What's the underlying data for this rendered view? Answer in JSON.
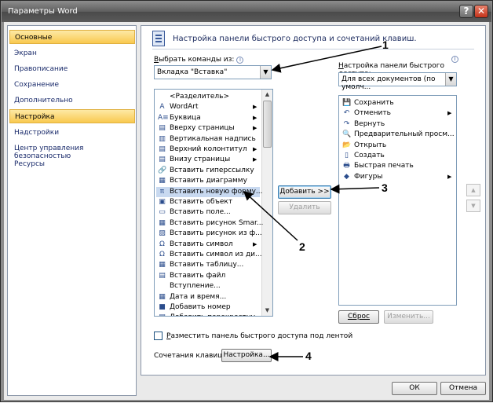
{
  "window": {
    "title": "Параметры Word"
  },
  "nav": {
    "items": [
      {
        "label": "Основные",
        "selected": true
      },
      {
        "label": "Экран",
        "selected": false
      },
      {
        "label": "Правописание",
        "selected": false
      },
      {
        "label": "Сохранение",
        "selected": false
      },
      {
        "label": "Дополнительно",
        "selected": false
      },
      {
        "label": "Настройка",
        "selected": true
      },
      {
        "label": "Надстройки",
        "selected": false
      },
      {
        "label": "Центр управления безопасностью",
        "selected": false
      },
      {
        "label": "Ресурсы",
        "selected": false
      }
    ]
  },
  "header": {
    "text": "Настройка панели быстрого доступа и сочетаний клавиш."
  },
  "commands": {
    "label_pre": "В",
    "label_rest": "ыбрать команды из:",
    "combo_value": "Вкладка \"Вставка\"",
    "items": [
      {
        "label": "<Разделитель>",
        "icon": "",
        "submenu": false
      },
      {
        "label": "WordArt",
        "icon": "A",
        "submenu": true
      },
      {
        "label": "Буквица",
        "icon": "A≡",
        "submenu": true
      },
      {
        "label": "Вверху страницы",
        "icon": "▤",
        "submenu": true
      },
      {
        "label": "Вертикальная надпись",
        "icon": "▥",
        "submenu": false
      },
      {
        "label": "Верхний колонтитул",
        "icon": "▤",
        "submenu": true
      },
      {
        "label": "Внизу страницы",
        "icon": "▤",
        "submenu": true
      },
      {
        "label": "Вставить гиперссылку",
        "icon": "🔗",
        "submenu": false
      },
      {
        "label": "Вставить диаграмму",
        "icon": "▦",
        "submenu": false
      },
      {
        "label": "Вставить новую форму...",
        "icon": "π",
        "submenu": false
      },
      {
        "label": "Вставить объект",
        "icon": "▣",
        "submenu": false
      },
      {
        "label": "Вставить поле...",
        "icon": "▭",
        "submenu": false
      },
      {
        "label": "Вставить рисунок Smar...",
        "icon": "▦",
        "submenu": false
      },
      {
        "label": "Вставить рисунок из ф...",
        "icon": "▨",
        "submenu": false
      },
      {
        "label": "Вставить символ",
        "icon": "Ω",
        "submenu": true
      },
      {
        "label": "Вставить символ из ди...",
        "icon": "Ω",
        "submenu": false
      },
      {
        "label": "Вставить таблицу...",
        "icon": "▦",
        "submenu": false
      },
      {
        "label": "Вставить файл",
        "icon": "▤",
        "submenu": false
      },
      {
        "label": "Вступление...",
        "icon": "",
        "submenu": false
      },
      {
        "label": "Дата и время...",
        "icon": "▦",
        "submenu": false
      },
      {
        "label": "Добавить номер",
        "icon": "■",
        "submenu": false
      },
      {
        "label": "Добавить перекрестну...",
        "icon": "▤",
        "submenu": false
      }
    ],
    "selected_index": 9
  },
  "qat": {
    "label_pre": "Н",
    "label_rest": "астройка панели быстрого\nдоступа:",
    "combo_value": "Для всех документов (по умолч...",
    "items": [
      {
        "label": "Сохранить",
        "icon": "💾",
        "submenu": false
      },
      {
        "label": "Отменить",
        "icon": "↶",
        "submenu": true
      },
      {
        "label": "Вернуть",
        "icon": "↷",
        "submenu": false
      },
      {
        "label": "Предварительный просм...",
        "icon": "🔍",
        "submenu": false
      },
      {
        "label": "Открыть",
        "icon": "📂",
        "submenu": false
      },
      {
        "label": "Создать",
        "icon": "▯",
        "submenu": false
      },
      {
        "label": "Быстрая печать",
        "icon": "🖶",
        "submenu": false
      },
      {
        "label": "Фигуры",
        "icon": "◆",
        "submenu": true
      }
    ]
  },
  "buttons": {
    "add": "Добавить >>",
    "remove": "Удалить",
    "reset": "Сброс",
    "modify": "Изменить...",
    "customize": "Настройка...",
    "ok": "ОК",
    "cancel": "Отмена"
  },
  "options": {
    "below_ribbon_pre": "Р",
    "below_ribbon_rest": "азместить панель быстрого доступа под лентой",
    "shortcuts_label": "Сочетания клавиш:"
  },
  "callouts": [
    "1",
    "2",
    "3",
    "4"
  ],
  "colors": {
    "nav_selected": "#f9c94f",
    "title_bar": "#5d5d5d",
    "close": "#c4321a"
  }
}
